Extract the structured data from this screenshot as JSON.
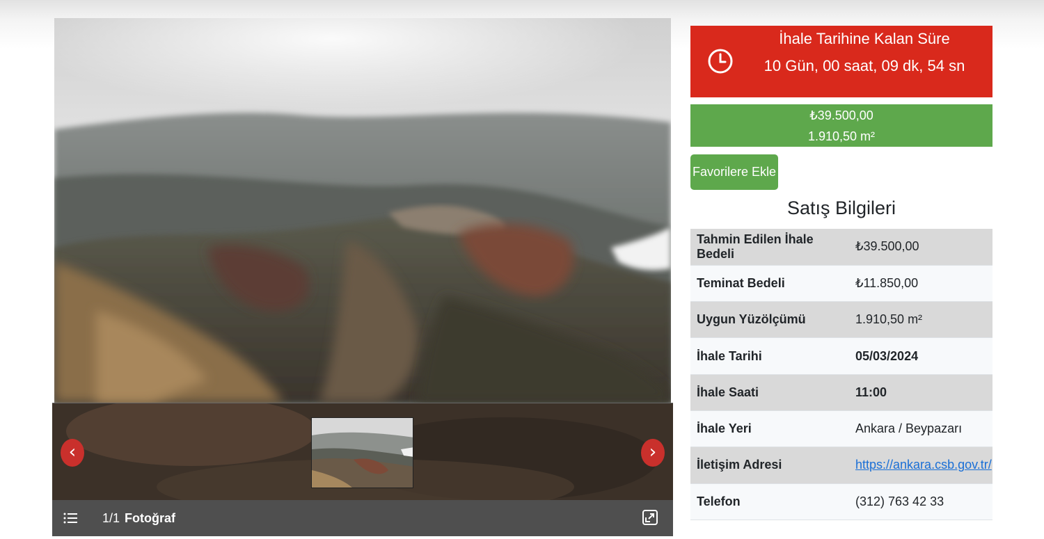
{
  "gallery": {
    "counter": "1/1",
    "label": "Fotoğraf",
    "prev_symbol": "‹",
    "next_symbol": "›"
  },
  "countdown": {
    "title": "İhale Tarihine Kalan Süre",
    "value": "10 Gün, 00 saat, 09 dk, 54 sn",
    "color": "#d9291c"
  },
  "summary": {
    "price": "₺39.500,00",
    "area": "1.910,50 m²",
    "color": "#5ea84c"
  },
  "favorite_button": "Favorilere Ekle",
  "sales_info": {
    "title": "Satış Bilgileri",
    "rows": [
      {
        "label": "Tahmin Edilen İhale Bedeli",
        "value": "₺39.500,00"
      },
      {
        "label": "Teminat Bedeli",
        "value": "₺11.850,00"
      },
      {
        "label": "Uygun Yüzölçümü",
        "value": "1.910,50 m²"
      },
      {
        "label": "İhale Tarihi",
        "value": "05/03/2024"
      },
      {
        "label": "İhale Saati",
        "value": "11:00"
      },
      {
        "label": "İhale Yeri",
        "value": "Ankara / Beypazarı"
      },
      {
        "label": "İletişim Adresi",
        "value": "https://ankara.csb.gov.tr/"
      },
      {
        "label": "Telefon",
        "value": "(312) 763 42 33"
      }
    ]
  }
}
